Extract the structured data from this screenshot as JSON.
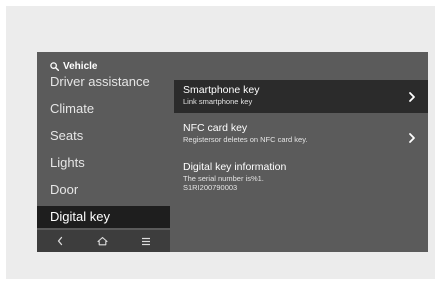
{
  "header": {
    "title": "Vehicle",
    "icon": "search-icon"
  },
  "sidebar": {
    "items": [
      {
        "label": "Driver assistance",
        "active": false
      },
      {
        "label": "Climate",
        "active": false
      },
      {
        "label": "Seats",
        "active": false
      },
      {
        "label": "Lights",
        "active": false
      },
      {
        "label": "Door",
        "active": false
      },
      {
        "label": "Digital key",
        "active": true
      }
    ]
  },
  "bottom_nav": {
    "icons": [
      "back-icon",
      "home-icon",
      "menu-icon"
    ]
  },
  "content": {
    "items": [
      {
        "title": "Smartphone key",
        "subtitle": "Link smartphone key",
        "has_arrow": true,
        "selected": true
      },
      {
        "title": "NFC card key",
        "subtitle": "Registersor deletes on NFC card key.",
        "has_arrow": true,
        "selected": false
      },
      {
        "title": "Digital key information",
        "subtitle": "The serial number is%1.",
        "subtitle2": "S1RI200790003",
        "has_arrow": false,
        "selected": false
      }
    ]
  },
  "colors": {
    "page_background": "#ffffff",
    "frame_background": "#ececec",
    "screen_background": "#5b5b5b",
    "active_item_background": "#1e1e1e",
    "selected_row_background": "#2b2b2b",
    "bottom_bar_background": "#3d3d3d",
    "text": "#ffffff"
  }
}
